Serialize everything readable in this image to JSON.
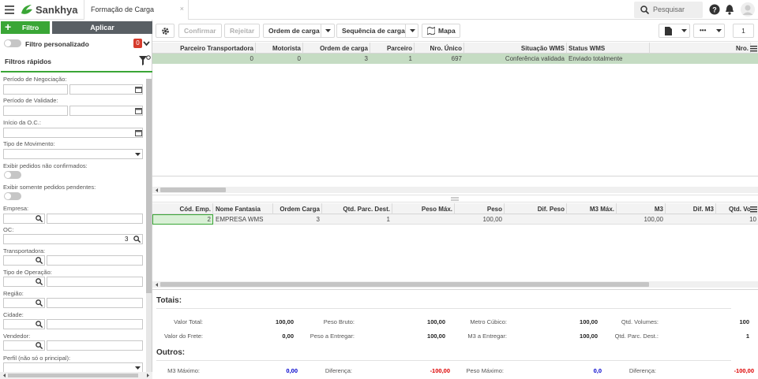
{
  "app": {
    "name": "Sankhya",
    "tab_title": "Formação de Carga",
    "tab_close": "×",
    "search_placeholder": "Pesquisar"
  },
  "colors": {
    "accent": "#3aa636",
    "dark": "#595f64",
    "selected_row": "#c5dcc3",
    "negative": "#dd0000",
    "blue": "#0000cc"
  },
  "filters": {
    "filtro_label": "Filtro",
    "aplicar_label": "Aplicar",
    "custom_label": "Filtro personalizado",
    "custom_badge": "0",
    "quick_label": "Filtros rápidos",
    "periodo_negociacao": "Período de Negociação:",
    "periodo_validade": "Período de Validade:",
    "inicio_oc": "Início da O.C.:",
    "tipo_movimento": "Tipo de Movimento:",
    "exibir_nao_confirmados": "Exibir pedidos não confirmados:",
    "exibir_pendentes": "Exibir somente pedidos pendentes:",
    "empresa": "Empresa:",
    "oc": "OC:",
    "oc_value": "3",
    "transportadora": "Transportadora:",
    "tipo_operacao": "Tipo de Operação:",
    "regiao": "Região:",
    "cidade": "Cidade:",
    "vendedor": "Vendedor:",
    "perfil": "Perfil (não só o principal):"
  },
  "toolbar": {
    "confirmar": "Confirmar",
    "rejeitar": "Rejeitar",
    "ordem_carga": "Ordem de carga",
    "sequencia_carga": "Sequência de carga",
    "mapa": "Mapa",
    "more": "•••",
    "page": "1"
  },
  "grid1": {
    "headers": [
      "Parceiro Transportadora",
      "Motorista",
      "Ordem de carga",
      "Parceiro",
      "Nro. Único",
      "Situação WMS",
      "Status WMS",
      "Nro."
    ],
    "row": [
      "0",
      "0",
      "3",
      "1",
      "697",
      "Conferência validada",
      "Enviado totalmente",
      ""
    ]
  },
  "grid2": {
    "headers": [
      "Cód. Emp.",
      "Nome Fantasia",
      "Ordem Carga",
      "Qtd. Parc. Dest.",
      "Peso Máx.",
      "Peso",
      "Dif. Peso",
      "M3 Máx.",
      "M3",
      "Dif. M3",
      "Qtd. Volu"
    ],
    "row": [
      "2",
      "EMPRESA WMS",
      "3",
      "1",
      "",
      "100,00",
      "",
      "",
      "100,00",
      "",
      "10"
    ]
  },
  "totais": {
    "title": "Totais:",
    "valor_total_l": "Valor Total:",
    "valor_total_v": "100,00",
    "valor_frete_l": "Valor do Frete:",
    "valor_frete_v": "0,00",
    "peso_bruto_l": "Peso Bruto:",
    "peso_bruto_v": "100,00",
    "peso_entregar_l": "Peso a Entregar:",
    "peso_entregar_v": "100,00",
    "metro_cubico_l": "Metro Cúbico:",
    "metro_cubico_v": "100,00",
    "m3_entregar_l": "M3 a Entregar:",
    "m3_entregar_v": "100,00",
    "qtd_volumes_l": "Qtd. Volumes:",
    "qtd_volumes_v": "100",
    "qtd_parc_l": "Qtd. Parc. Dest.:",
    "qtd_parc_v": "1"
  },
  "outros": {
    "title": "Outros:",
    "m3_max_l": "M3 Máximo:",
    "m3_max_v": "0,00",
    "dif1_l": "Diferença:",
    "dif1_v": "-100,00",
    "peso_max_l": "Peso Máximo:",
    "peso_max_v": "0,0",
    "dif2_l": "Diferença:",
    "dif2_v": "-100,00"
  }
}
